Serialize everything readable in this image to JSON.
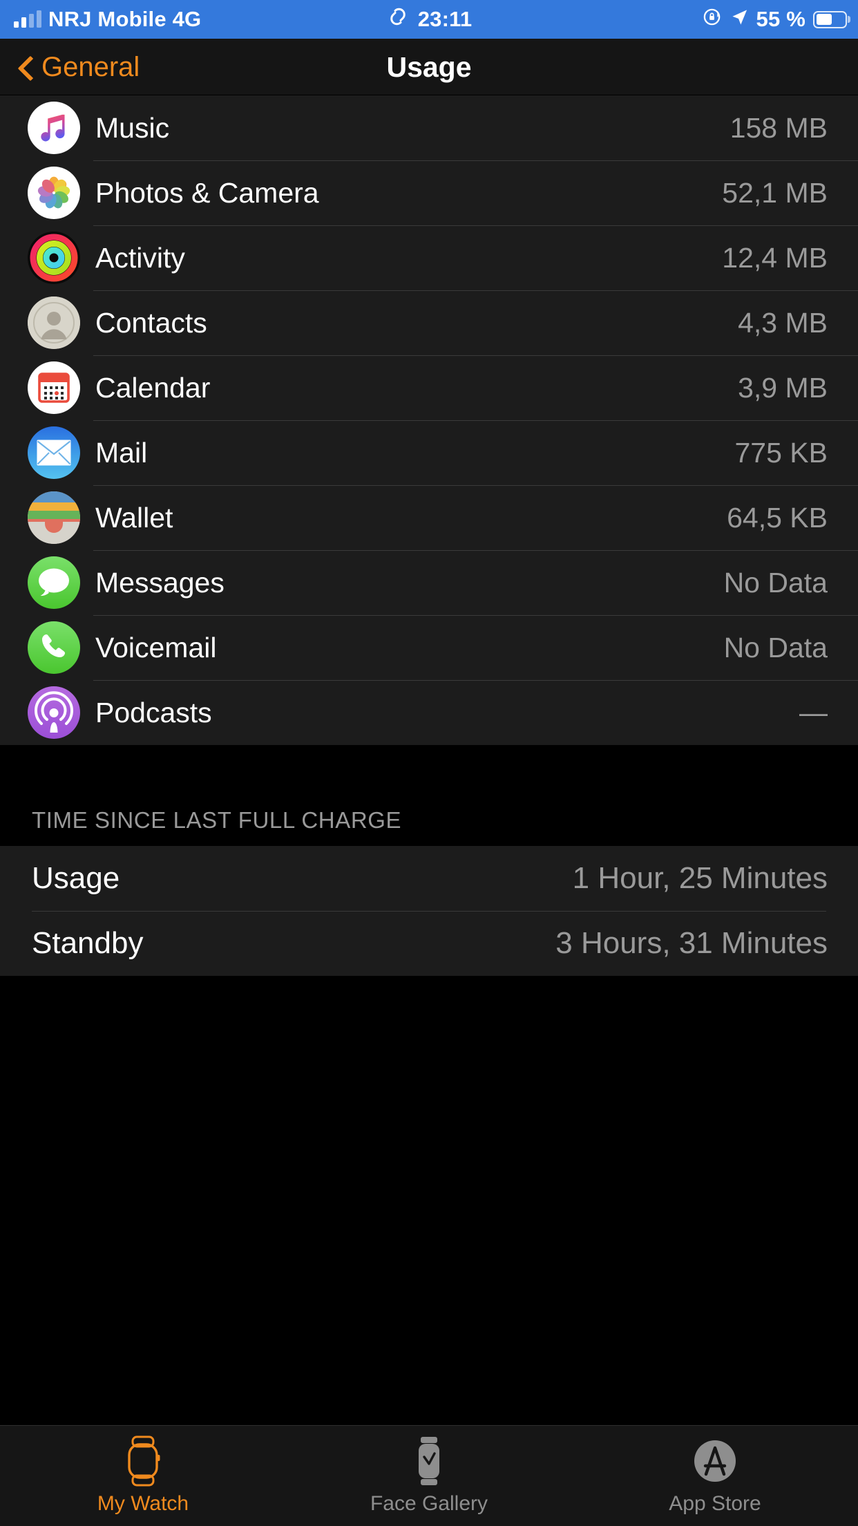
{
  "status_bar": {
    "carrier": "NRJ Mobile 4G",
    "time": "23:11",
    "battery_percent": "55 %",
    "signal_bars_filled": 2,
    "signal_bars_total": 4,
    "icons": [
      "cellular-signal-icon",
      "screen-mirroring-icon",
      "rotation-lock-icon",
      "location-arrow-icon",
      "battery-icon"
    ],
    "background_color": "#3479dc"
  },
  "nav_bar": {
    "back_label": "General",
    "title": "Usage",
    "accent_color": "#f08a1e"
  },
  "app_usage": {
    "rows": [
      {
        "icon": "music-icon",
        "label": "Music",
        "value": "158 MB"
      },
      {
        "icon": "photos-icon",
        "label": "Photos & Camera",
        "value": "52,1 MB"
      },
      {
        "icon": "activity-icon",
        "label": "Activity",
        "value": "12,4 MB"
      },
      {
        "icon": "contacts-icon",
        "label": "Contacts",
        "value": "4,3 MB"
      },
      {
        "icon": "calendar-icon",
        "label": "Calendar",
        "value": "3,9 MB"
      },
      {
        "icon": "mail-icon",
        "label": "Mail",
        "value": "775 KB"
      },
      {
        "icon": "wallet-icon",
        "label": "Wallet",
        "value": "64,5 KB"
      },
      {
        "icon": "messages-icon",
        "label": "Messages",
        "value": "No Data"
      },
      {
        "icon": "voicemail-icon",
        "label": "Voicemail",
        "value": "No Data"
      },
      {
        "icon": "podcasts-icon",
        "label": "Podcasts",
        "value": "—"
      }
    ]
  },
  "charge_section": {
    "header": "TIME SINCE LAST FULL CHARGE",
    "rows": [
      {
        "label": "Usage",
        "value": "1 Hour, 25 Minutes"
      },
      {
        "label": "Standby",
        "value": "3 Hours, 31 Minutes"
      }
    ]
  },
  "tab_bar": {
    "tabs": [
      {
        "label": "My Watch",
        "icon": "watch-icon",
        "active": true
      },
      {
        "label": "Face Gallery",
        "icon": "watch-face-icon",
        "active": false
      },
      {
        "label": "App Store",
        "icon": "app-store-icon",
        "active": false
      }
    ],
    "active_color": "#f08a1e",
    "inactive_color": "#8e8e8e"
  }
}
